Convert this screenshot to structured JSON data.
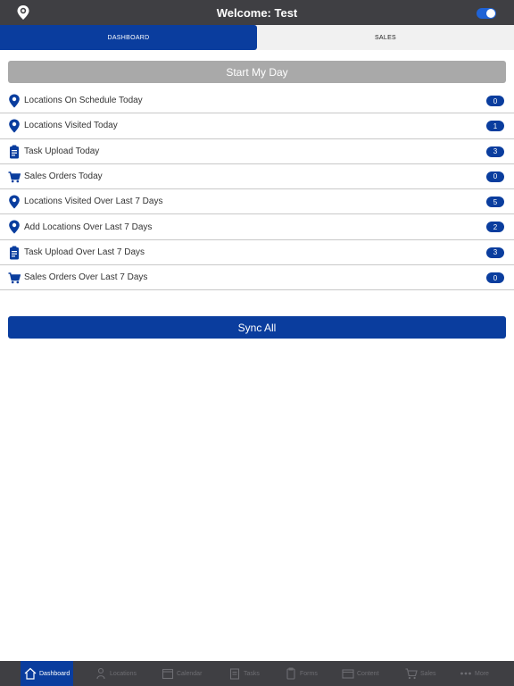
{
  "header": {
    "title": "Welcome: Test"
  },
  "tabs": [
    {
      "label": "DASHBOARD",
      "active": true
    },
    {
      "label": "SALES",
      "active": false
    }
  ],
  "start_button": "Start My Day",
  "stats": [
    {
      "label": "Locations On Schedule Today",
      "count": "0",
      "icon": "location-pin-icon"
    },
    {
      "label": "Locations Visited Today",
      "count": "1",
      "icon": "location-pin-icon"
    },
    {
      "label": "Task Upload Today",
      "count": "3",
      "icon": "clipboard-icon"
    },
    {
      "label": "Sales Orders Today",
      "count": "0",
      "icon": "cart-icon"
    },
    {
      "label": "Locations Visited Over Last 7 Days",
      "count": "5",
      "icon": "location-pin-icon"
    },
    {
      "label": "Add Locations Over Last 7 Days",
      "count": "2",
      "icon": "location-pin-icon"
    },
    {
      "label": "Task Upload Over Last 7 Days",
      "count": "3",
      "icon": "clipboard-icon"
    },
    {
      "label": "Sales Orders Over Last 7 Days",
      "count": "0",
      "icon": "cart-icon"
    }
  ],
  "sync_button": "Sync All",
  "bottom_nav": [
    {
      "label": "Dashboard",
      "icon": "home-icon",
      "active": true
    },
    {
      "label": "Locations",
      "icon": "person-pin-icon"
    },
    {
      "label": "Calendar",
      "icon": "calendar-icon"
    },
    {
      "label": "Tasks",
      "icon": "tasks-icon"
    },
    {
      "label": "Forms",
      "icon": "forms-icon"
    },
    {
      "label": "Content",
      "icon": "folder-icon"
    },
    {
      "label": "Sales",
      "icon": "cart-icon"
    },
    {
      "label": "More",
      "icon": "more-dots-icon"
    }
  ],
  "colors": {
    "bar": "#3f3f43",
    "accent": "#0a3d9e",
    "disabled": "#a9a9a9",
    "toggle": "#1f63d6"
  }
}
